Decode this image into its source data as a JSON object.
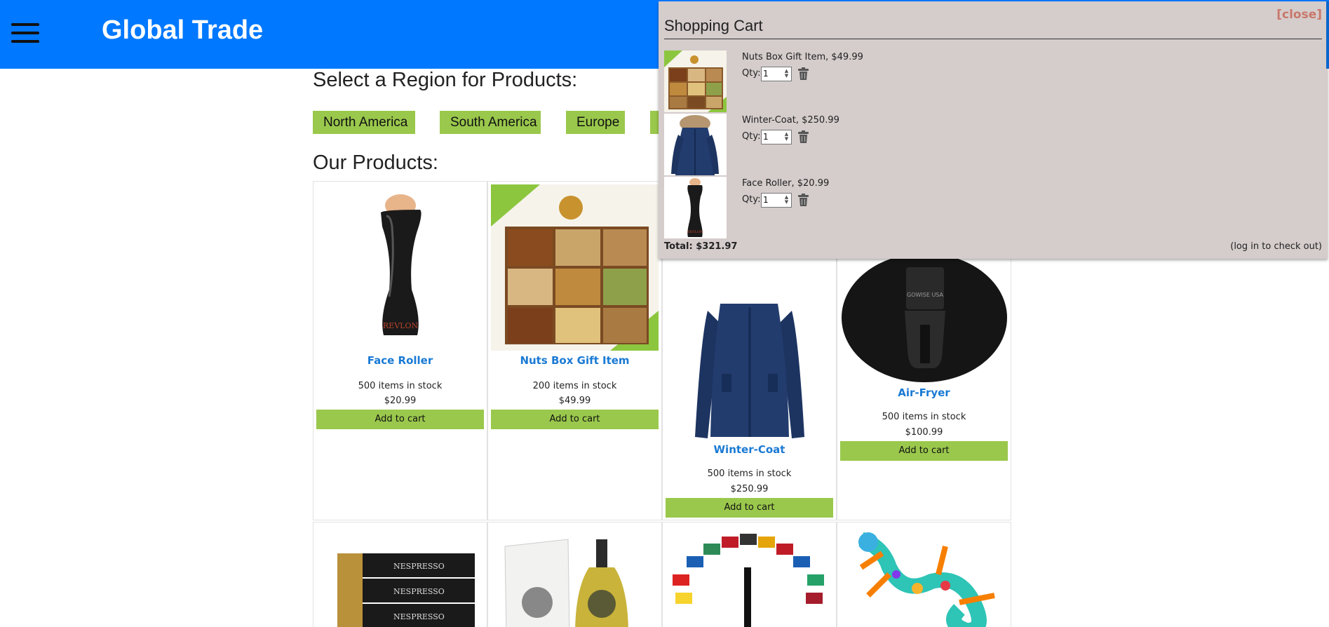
{
  "header": {
    "brand": "Global Trade",
    "menu_icon": "hamburger-menu-icon",
    "background": "#0078ff"
  },
  "regions": {
    "heading": "Select a Region for Products:",
    "buttons": [
      "North America",
      "South America",
      "Europe",
      ""
    ]
  },
  "products": {
    "heading": "Our Products:",
    "button_color": "#9ac84c",
    "items": [
      {
        "name": "Face Roller",
        "stock": "500 items in stock",
        "price": "$20.99",
        "action": "Add to cart",
        "image": "face-roller-image"
      },
      {
        "name": "Nuts Box Gift Item",
        "stock": "200 items in stock",
        "price": "$49.99",
        "action": "Add to cart",
        "image": "nuts-box-image"
      },
      {
        "name": "Winter-Coat",
        "stock": "500 items in stock",
        "price": "$250.99",
        "action": "Add to cart",
        "image": "winter-coat-image"
      },
      {
        "name": "Air-Fryer",
        "stock": "500 items in stock",
        "price": "$100.99",
        "action": "Add to cart",
        "image": "air-fryer-image"
      },
      {
        "image": "coffee-capsules-image"
      },
      {
        "image": "olive-oil-image"
      },
      {
        "image": "world-flags-image"
      },
      {
        "image": "gecko-art-image"
      }
    ]
  },
  "cart": {
    "title": "Shopping Cart",
    "close": "[close]",
    "qty_label": "Qty:",
    "items": [
      {
        "label": "Nuts Box Gift Item, $49.99",
        "qty": "1",
        "image": "nuts-box-image"
      },
      {
        "label": "Winter-Coat, $250.99",
        "qty": "1",
        "image": "winter-coat-image"
      },
      {
        "label": "Face Roller, $20.99",
        "qty": "1",
        "image": "face-roller-image"
      }
    ],
    "total": "Total: $321.97",
    "checkout_note": "(log in to check out)",
    "background": "#d5cccc"
  }
}
